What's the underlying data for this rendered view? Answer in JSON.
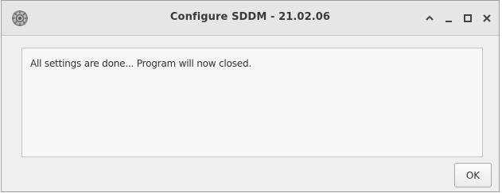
{
  "window": {
    "title": "Configure SDDM - 21.02.06",
    "app_icon": "gear-globe-icon",
    "controls": {
      "shade_icon": "chevron-up-icon",
      "minimize_icon": "minimize-icon",
      "maximize_icon": "maximize-icon",
      "close_icon": "close-icon"
    }
  },
  "message": {
    "text": "All settings are done... Program will now closed."
  },
  "buttons": {
    "ok_label": "OK"
  }
}
